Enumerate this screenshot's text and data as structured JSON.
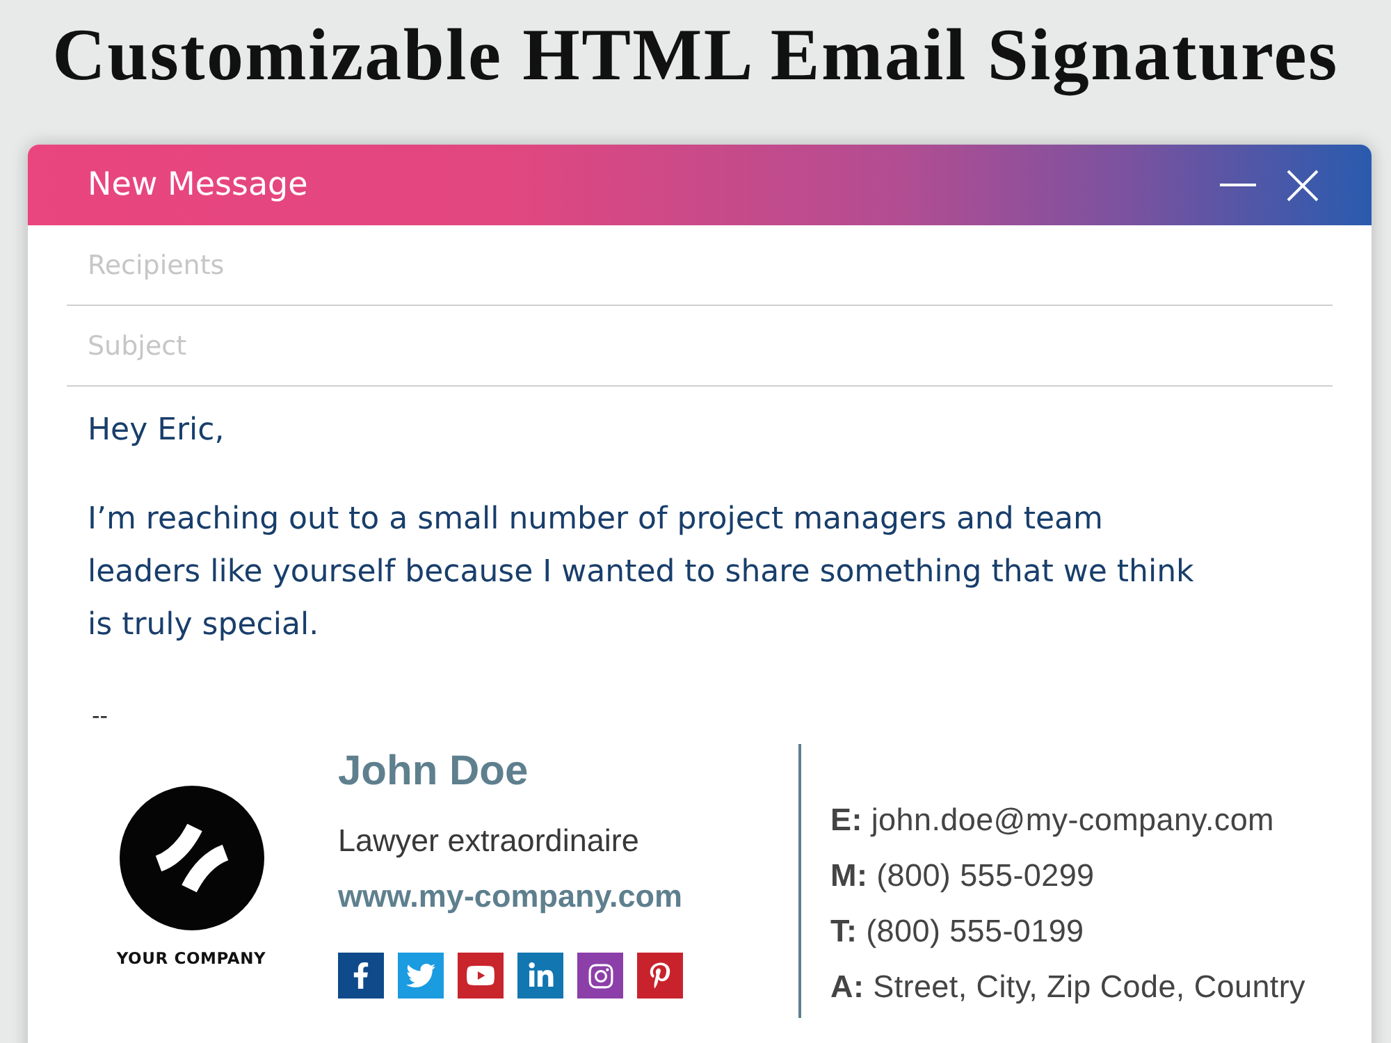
{
  "heading": "Customizable HTML Email Signatures",
  "window": {
    "title": "New Message"
  },
  "fields": [
    {
      "placeholder": "Recipients"
    },
    {
      "placeholder": "Subject"
    }
  ],
  "body": {
    "greeting": "Hey Eric,",
    "paragraph": "I’m reaching out to a small number of project managers and team leaders like yourself because I wanted to share something that we think is truly special.",
    "separator": "--"
  },
  "signature": {
    "logo_text": "YOUR COMPANY",
    "name": "John Doe",
    "title": "Lawyer extraordinaire",
    "website": "www.my-company.com",
    "social": [
      {
        "kind": "facebook",
        "color": "#0f4a8a"
      },
      {
        "kind": "twitter",
        "color": "#1b9be0"
      },
      {
        "kind": "youtube",
        "color": "#c9252c"
      },
      {
        "kind": "linkedin",
        "color": "#1276b0"
      },
      {
        "kind": "instagram",
        "color": "#8c3fa9"
      },
      {
        "kind": "pinterest",
        "color": "#c8232c"
      }
    ],
    "contacts": [
      "**E:** john.doe@my-company.com",
      "**M:** (800) 555-0299",
      "**T:** (800) 555-0199",
      "**A:** Street, City, Zip Code, Country"
    ]
  }
}
